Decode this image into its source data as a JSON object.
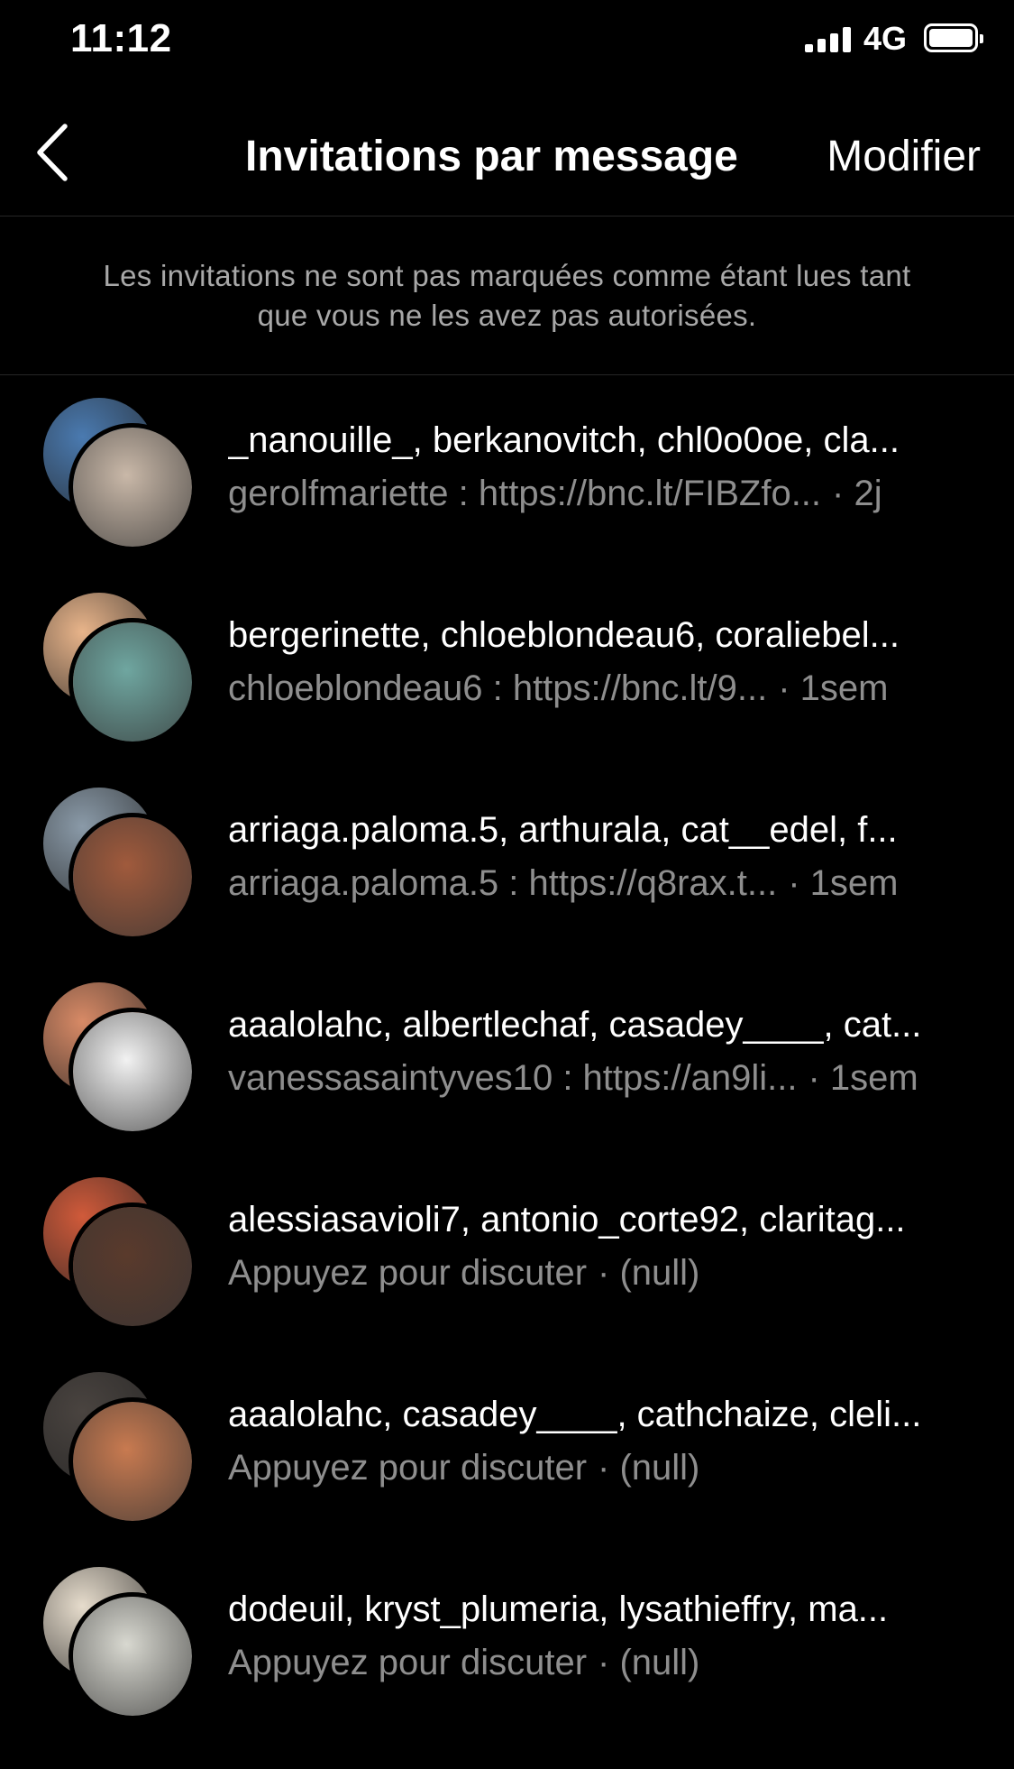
{
  "status_bar": {
    "time": "11:12",
    "network": "4G",
    "signal_icon": "cellular-signal-icon",
    "battery_icon": "battery-full-icon"
  },
  "header": {
    "back_icon": "chevron-left-icon",
    "title": "Invitations par message",
    "edit_label": "Modifier"
  },
  "info_note": "Les invitations ne sont pas marquées comme étant lues tant que vous ne les avez pas autorisées.",
  "colors": {
    "background": "#000000",
    "primary_text": "#ffffff",
    "secondary_text": "#8e8e8e",
    "note_text": "#a8a8a8",
    "divider": "#262626"
  },
  "threads": [
    {
      "names": "_nanouille_, berkanovitch, chl0o0oe, cla...",
      "preview": "gerolfmariette : https://bnc.lt/FIBZfo...",
      "time": "· 2j",
      "back_color": "#4a7ab0",
      "front_color": "#c9b8a8"
    },
    {
      "names": "bergerinette, chloeblondeau6, coraliebel...",
      "preview": "chloeblondeau6 : https://bnc.lt/9...",
      "time": "· 1sem",
      "back_color": "#e8b48a",
      "front_color": "#6fa6a0"
    },
    {
      "names": "arriaga.paloma.5, arthurala, cat__edel, f...",
      "preview": "arriaga.paloma.5 : https://q8rax.t...",
      "time": "· 1sem",
      "back_color": "#8a9aa8",
      "front_color": "#a05a3c"
    },
    {
      "names": "aaalolahc, albertlechaf, casadey____, cat...",
      "preview": "vanessasaintyves10 : https://an9li...",
      "time": "· 1sem",
      "back_color": "#d88a66",
      "front_color": "#f2f2f2"
    },
    {
      "names": "alessiasavioli7, antonio_corte92, claritag...",
      "preview": "Appuyez pour discuter",
      "time": "· (null)",
      "back_color": "#d05a3a",
      "front_color": "#5a3a2c"
    },
    {
      "names": "aaalolahc, casadey____, cathchaize, cleli...",
      "preview": "Appuyez pour discuter",
      "time": "· (null)",
      "back_color": "#4a4440",
      "front_color": "#c87a50"
    },
    {
      "names": "dodeuil, kryst_plumeria, lysathieffry, ma...",
      "preview": "Appuyez pour discuter",
      "time": "· (null)",
      "back_color": "#e6dccc",
      "front_color": "#d8d8d0"
    }
  ]
}
